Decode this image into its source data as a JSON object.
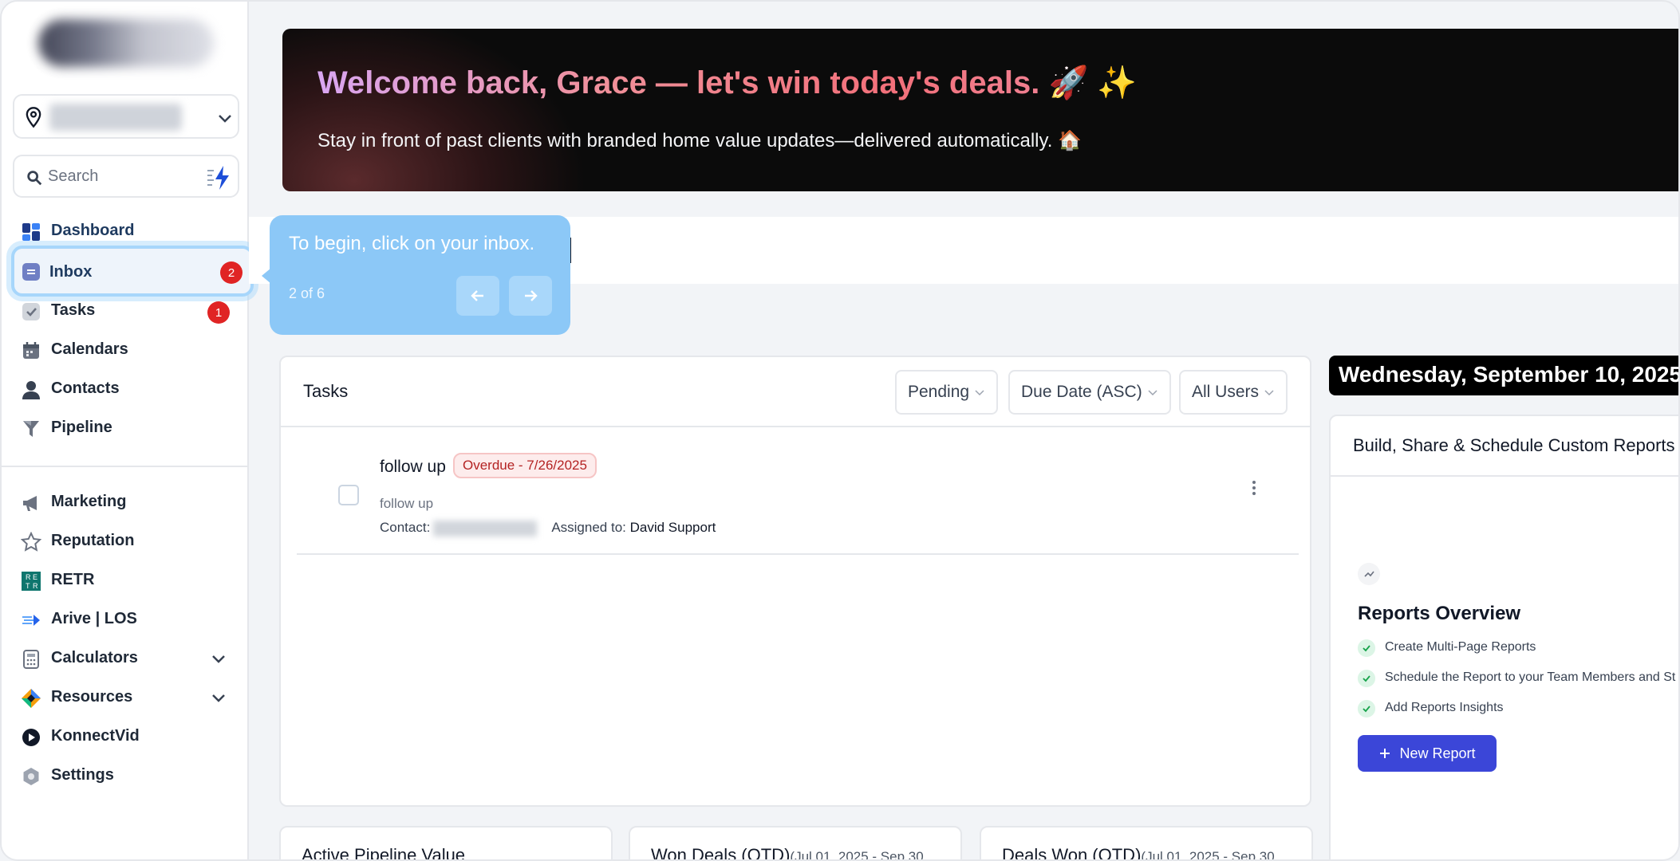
{
  "sidebar": {
    "search_placeholder": "Search",
    "items": [
      {
        "label": "Dashboard"
      },
      {
        "label": "Inbox",
        "badge": "2"
      },
      {
        "label": "Tasks",
        "badge": "1"
      },
      {
        "label": "Calendars"
      },
      {
        "label": "Contacts"
      },
      {
        "label": "Pipeline"
      },
      {
        "label": "Marketing"
      },
      {
        "label": "Reputation"
      },
      {
        "label": "RETR"
      },
      {
        "label": "Arive | LOS"
      },
      {
        "label": "Calculators"
      },
      {
        "label": "Resources"
      },
      {
        "label": "KonnectVid"
      },
      {
        "label": "Settings"
      }
    ]
  },
  "banner": {
    "title": "Welcome back, Grace — let's win today's deals.",
    "title_emoji": "🚀 ✨",
    "subtitle": "Stay in front of past clients with branded home value updates—delivered automatically. 🏠"
  },
  "tooltip": {
    "text": "To begin, click on your inbox.",
    "step": "2 of 6"
  },
  "tasks": {
    "title": "Tasks",
    "filters": [
      "Pending",
      "Due Date (ASC)",
      "All Users"
    ],
    "items": [
      {
        "title": "follow up",
        "status": "Overdue - 7/26/2025",
        "description": "follow up",
        "contact_label": "Contact:",
        "assigned_label": "Assigned to:",
        "assignee": "David Support"
      }
    ]
  },
  "date_header": "Wednesday, September 10, 2025",
  "reports": {
    "title": "Build, Share & Schedule Custom Reports",
    "overview_title": "Reports Overview",
    "bullets": [
      "Create Multi-Page Reports",
      "Schedule the Report to your Team Members and St",
      "Add Reports Insights"
    ],
    "button": "New Report"
  },
  "bottom_cards": [
    {
      "title": "Active Pipeline Value",
      "range": ""
    },
    {
      "title": "Won Deals (QTD)",
      "range": "(Jul 01, 2025 - Sep 30"
    },
    {
      "title": "Deals Won (QTD)",
      "range": "(Jul 01, 2025 - Sep 30"
    }
  ],
  "colors": {
    "accent": "#3b46d8",
    "badge": "#e02424",
    "tooltip": "#8cc8f7",
    "overdue_text": "#b42323"
  }
}
